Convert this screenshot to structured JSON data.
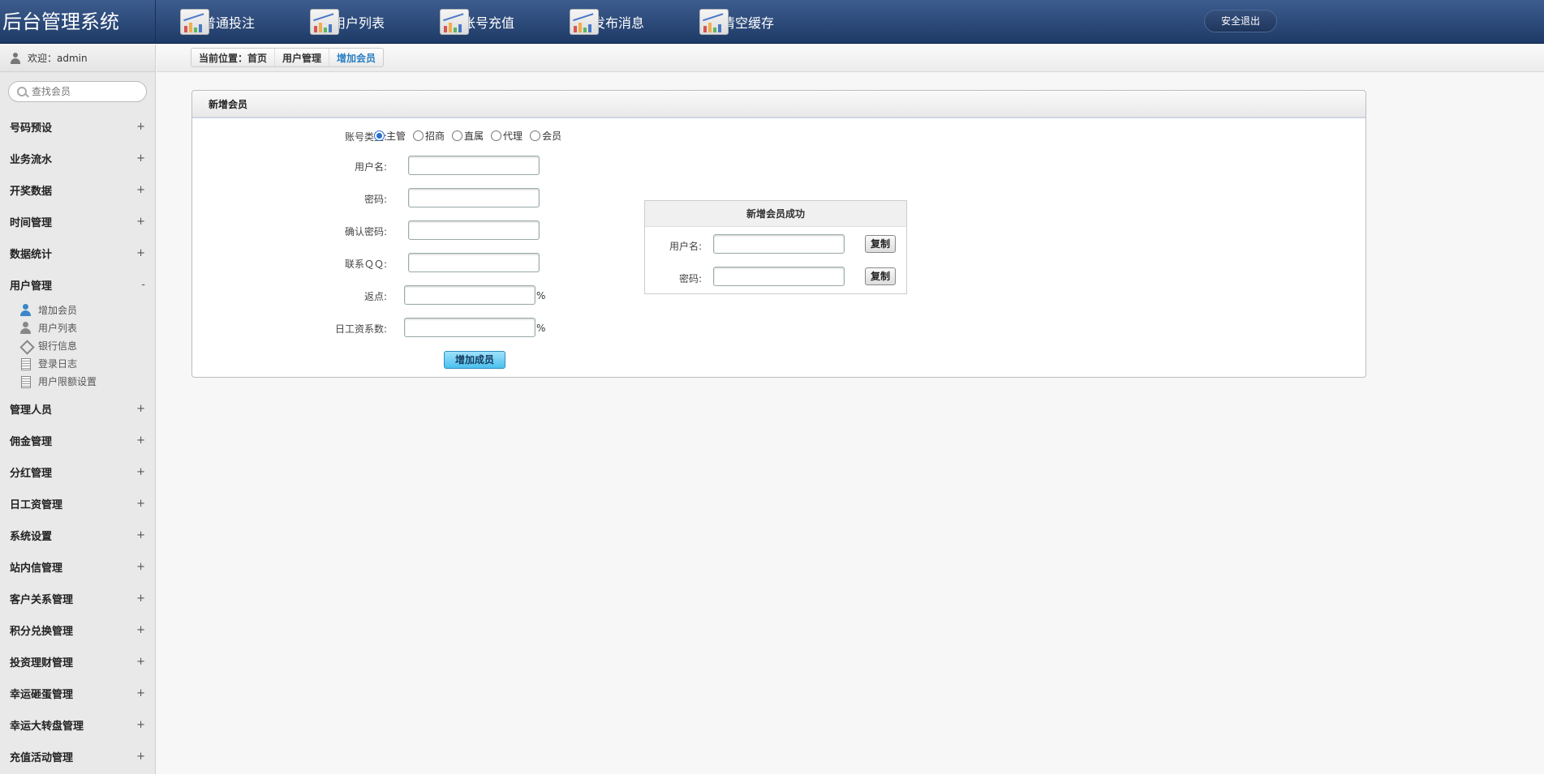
{
  "app": {
    "title": "后台管理系统",
    "logout": "安全退出"
  },
  "topnav": [
    {
      "label": "普通投注"
    },
    {
      "label": "用户列表"
    },
    {
      "label": "账号充值"
    },
    {
      "label": "发布消息"
    },
    {
      "label": "清空缓存"
    }
  ],
  "sidebar": {
    "welcome": "欢迎：admin",
    "search_placeholder": "查找会员",
    "menu": [
      {
        "label": "号码预设",
        "sign": "+"
      },
      {
        "label": "业务流水",
        "sign": "+"
      },
      {
        "label": "开奖数据",
        "sign": "+"
      },
      {
        "label": "时间管理",
        "sign": "+"
      },
      {
        "label": "数据统计",
        "sign": "+"
      },
      {
        "label": "用户管理",
        "sign": "-"
      },
      {
        "label": "管理人员",
        "sign": "+"
      },
      {
        "label": "佣金管理",
        "sign": "+"
      },
      {
        "label": "分红管理",
        "sign": "+"
      },
      {
        "label": "日工资管理",
        "sign": "+"
      },
      {
        "label": "系统设置",
        "sign": "+"
      },
      {
        "label": "站内信管理",
        "sign": "+"
      },
      {
        "label": "客户关系管理",
        "sign": "+"
      },
      {
        "label": "积分兑换管理",
        "sign": "+"
      },
      {
        "label": "投资理财管理",
        "sign": "+"
      },
      {
        "label": "幸运砸蛋管理",
        "sign": "+"
      },
      {
        "label": "幸运大转盘管理",
        "sign": "+"
      },
      {
        "label": "充值活动管理",
        "sign": "+"
      }
    ],
    "submenu": [
      {
        "label": "增加会员",
        "icon": "user-add-icon"
      },
      {
        "label": "用户列表",
        "icon": "user-icon"
      },
      {
        "label": "银行信息",
        "icon": "diamond-icon"
      },
      {
        "label": "登录日志",
        "icon": "document-icon"
      },
      {
        "label": "用户限额设置",
        "icon": "document-icon"
      }
    ]
  },
  "breadcrumb": {
    "prefix": "当前位置：",
    "home": "首页",
    "section": "用户管理",
    "current": "增加会员"
  },
  "form": {
    "title": "新增会员",
    "account_type_label": "账号类型:",
    "account_types": [
      "主管",
      "招商",
      "直属",
      "代理",
      "会员"
    ],
    "selected_type": "主管",
    "username_label": "用户名:",
    "username_value": "",
    "password_label": "密码:",
    "password_value": "",
    "confirm_label": "确认密码:",
    "confirm_value": "",
    "qq_label": "联系ＱＱ:",
    "qq_value": "",
    "rebate_label": "返点:",
    "rebate_value": "",
    "rebate_unit": "%",
    "wage_label": "日工资系数:",
    "wage_value": "",
    "wage_unit": "%",
    "submit": "增加成员"
  },
  "success": {
    "title": "新增会员成功",
    "username_label": "用户名:",
    "username_value": "",
    "password_label": "密码:",
    "password_value": "",
    "copy": "复制"
  }
}
